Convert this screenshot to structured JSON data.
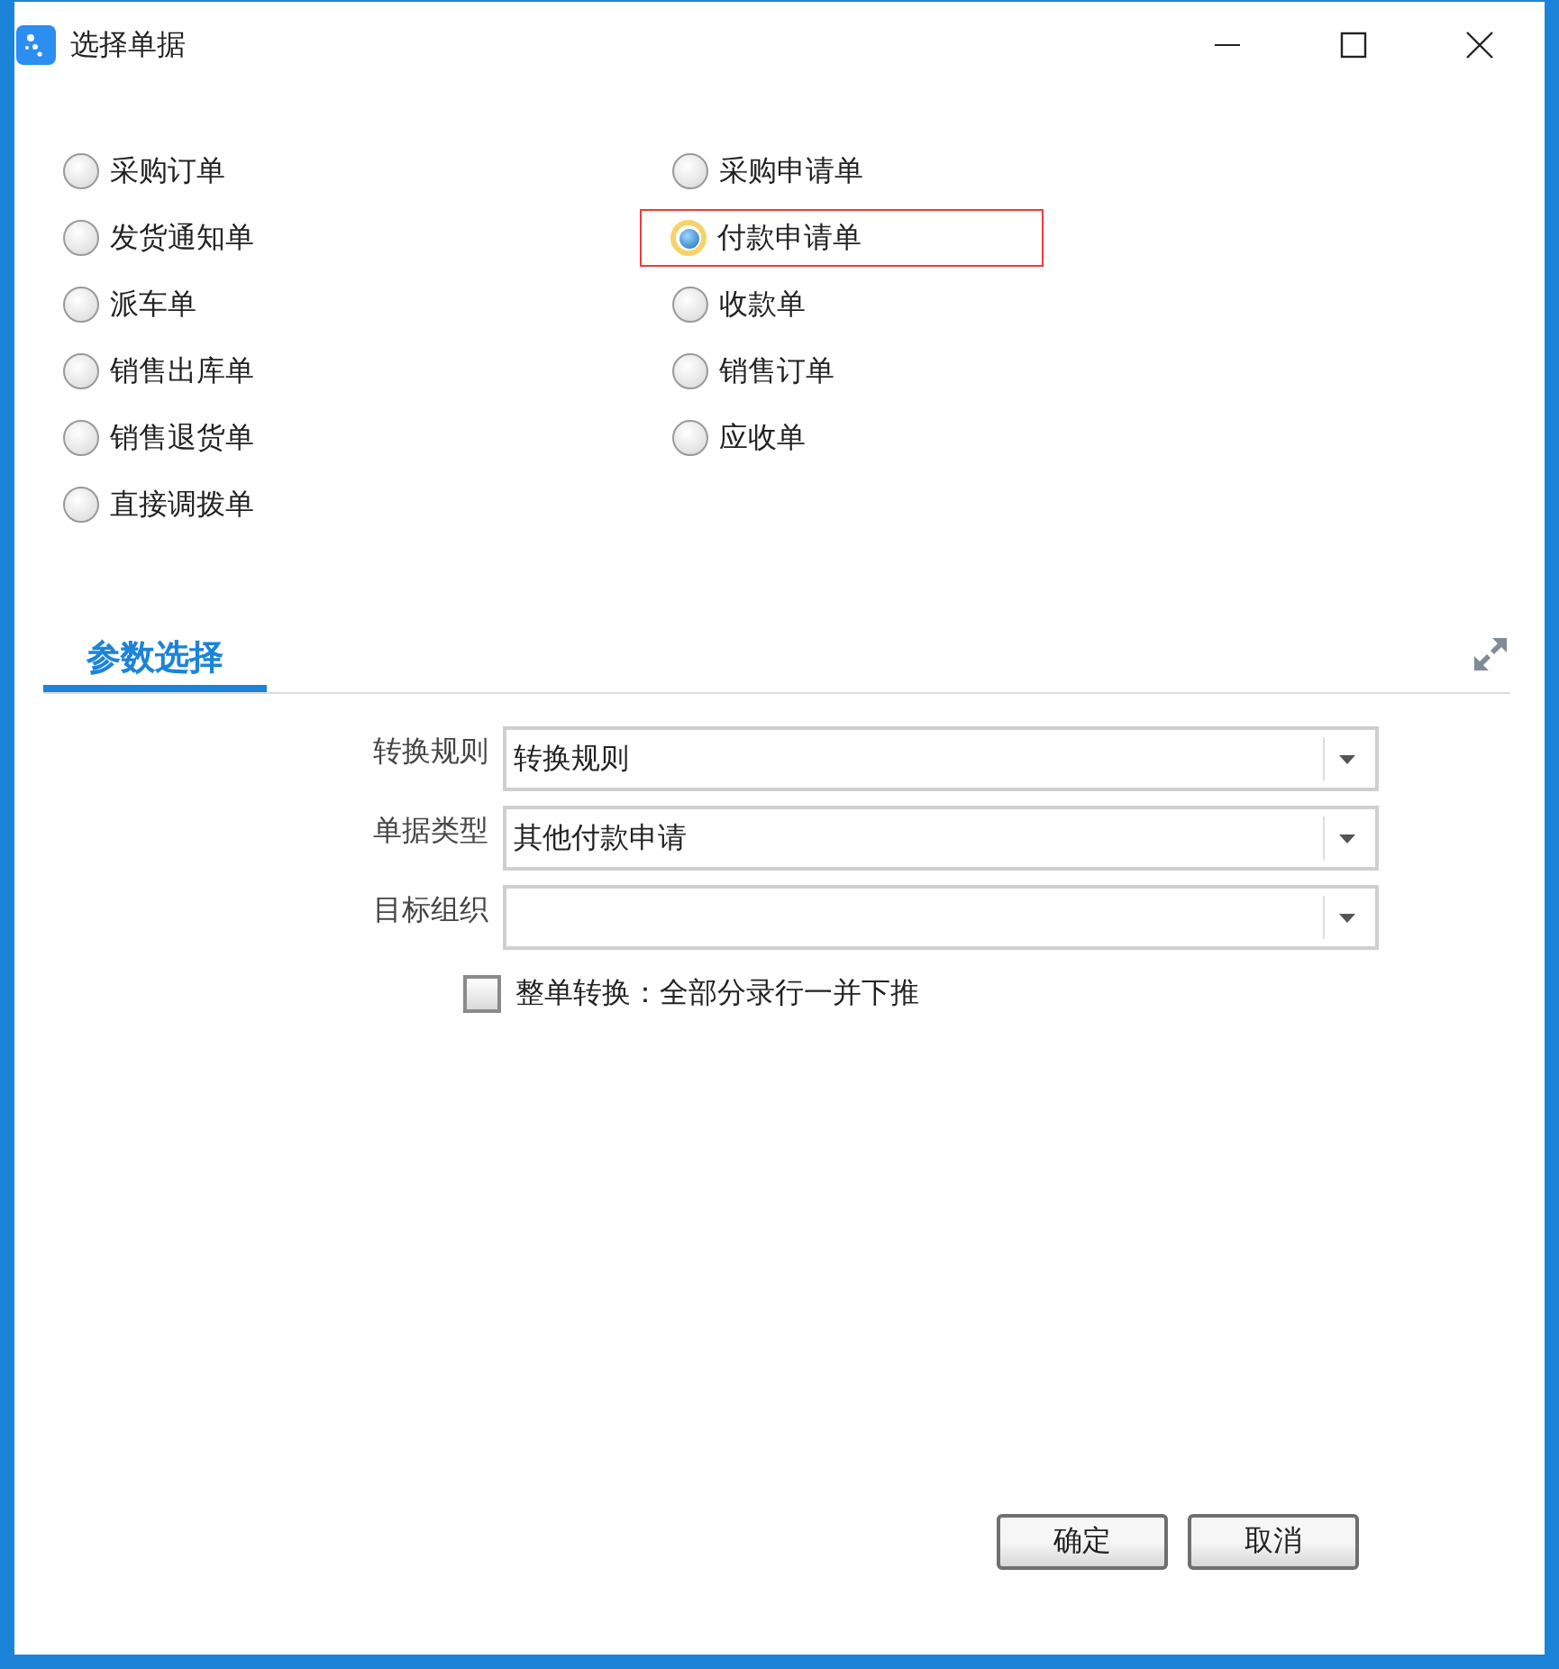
{
  "window": {
    "title": "选择单据"
  },
  "options": [
    {
      "label": "采购订单",
      "selected": false
    },
    {
      "label": "采购申请单",
      "selected": false
    },
    {
      "label": "发货通知单",
      "selected": false
    },
    {
      "label": "付款申请单",
      "selected": true
    },
    {
      "label": "派车单",
      "selected": false
    },
    {
      "label": "收款单",
      "selected": false
    },
    {
      "label": "销售出库单",
      "selected": false
    },
    {
      "label": "销售订单",
      "selected": false
    },
    {
      "label": "销售退货单",
      "selected": false
    },
    {
      "label": "应收单",
      "selected": false
    },
    {
      "label": "直接调拨单",
      "selected": false
    }
  ],
  "tabs": [
    {
      "label": "参数选择",
      "selected": true
    }
  ],
  "fields": [
    {
      "label": "转换规则",
      "value": "转换规则"
    },
    {
      "label": "单据类型",
      "value": "其他付款申请"
    },
    {
      "label": "目标组织"
    }
  ],
  "whole_convert": {
    "label": "整单转换：全部分录行一并下推",
    "checked": false
  },
  "buttons": [
    "确定",
    "取消"
  ]
}
